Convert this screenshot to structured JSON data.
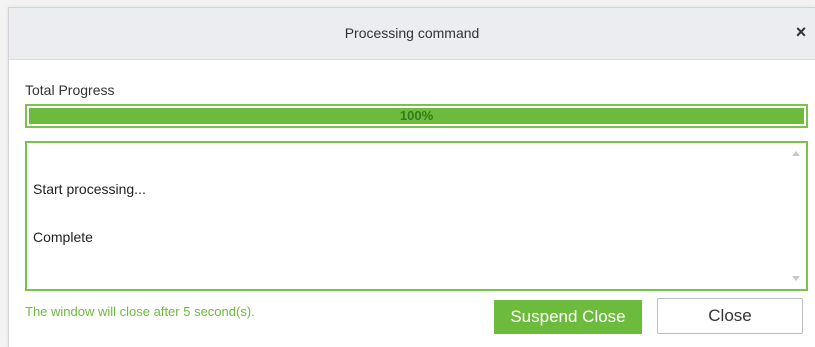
{
  "dialog": {
    "title": "Processing command",
    "close_icon": "close-icon",
    "close_glyph": "×"
  },
  "progress": {
    "label": "Total Progress",
    "percent": 100,
    "text": "100%",
    "color": "#6dbb3c",
    "border_color": "#7cc24a"
  },
  "log": {
    "lines": [
      "Start processing...",
      "Complete"
    ]
  },
  "footer": {
    "countdown_text": "The window will close after 5 second(s).",
    "suspend_label": "Suspend Close",
    "close_label": "Close",
    "accent_color": "#6dbb3c"
  }
}
